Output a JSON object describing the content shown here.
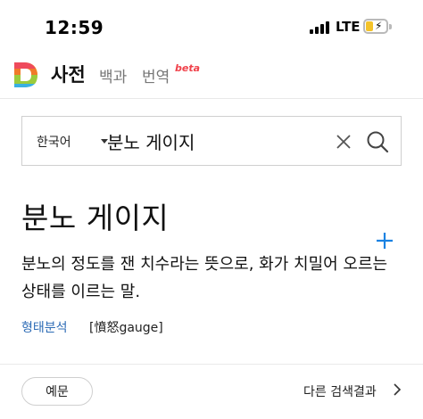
{
  "status_bar": {
    "time": "12:59",
    "network": "LTE",
    "signal_bars": 4,
    "battery_charging": true,
    "battery_level": 0.35
  },
  "header": {
    "logo_letter": "D",
    "tabs": [
      {
        "label": "사전",
        "active": true
      },
      {
        "label": "백과",
        "active": false
      },
      {
        "label": "번역",
        "active": false
      }
    ],
    "beta_badge": "beta"
  },
  "search": {
    "language": "한국어",
    "query": "분노 게이지"
  },
  "entry": {
    "title": "분노 게이지",
    "definition": "분노의 정도를 잰 치수라는 뜻으로, 화가 치밀어 오르는 상태를 이르는 말.",
    "morph_link": "형태분석",
    "origin": "[憤怒gauge]"
  },
  "footer": {
    "example_button": "예문",
    "other_results": "다른 검색결과"
  },
  "colors": {
    "accent_link": "#2c6bb5",
    "add_icon": "#1a82e2",
    "beta": "#f0424b",
    "battery_fill": "#f4c32a"
  }
}
